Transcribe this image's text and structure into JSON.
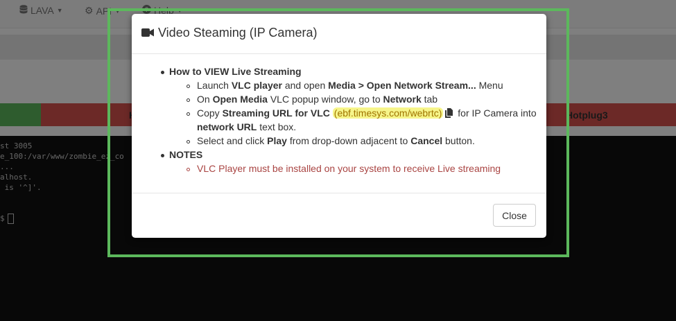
{
  "navbar": {
    "items": [
      {
        "label": "LAVA",
        "icon": "database-icon"
      },
      {
        "label": "API",
        "icon": "gear-icon"
      },
      {
        "label": "Help",
        "icon": "question-circle-icon"
      }
    ]
  },
  "tabs": {
    "left_label": "H",
    "right_label": "Hotplug3"
  },
  "terminal": {
    "lines": [
      "st 3005",
      "e_100:/var/www/zombie_ez_co",
      "...",
      "alhost.",
      " is '^]'.",
      "",
      "$"
    ]
  },
  "modal": {
    "title": "Video Steaming (IP Camera)",
    "title_icon": "video-camera-icon",
    "section1": {
      "heading": "How to VIEW Live Streaming",
      "step1": {
        "a": "Launch ",
        "b": "VLC player",
        "c": " and open ",
        "d": "Media > Open Network Stream...",
        "e": " Menu"
      },
      "step2": {
        "a": "On ",
        "b": "Open Media",
        "c": " VLC popup window, go to ",
        "d": "Network",
        "e": " tab"
      },
      "step3": {
        "a": "Copy ",
        "b": "Streaming URL for VLC",
        "url": "(ebf.timesys.com/webrtc)",
        "c": " for IP Camera into",
        "d": "network URL",
        "e": " text box."
      },
      "step4": {
        "a": "Select and click ",
        "b": "Play",
        "c": " from drop-down adjacent to ",
        "d": "Cancel",
        "e": " button."
      }
    },
    "section2": {
      "heading": "NOTES",
      "note1": "VLC Player must be installed on your system to receive Live streaming"
    },
    "close_label": "Close"
  },
  "colors": {
    "highlight_border": "#5cb85c",
    "tab_green": "#5cb85c",
    "tab_red": "#d9534f",
    "url_highlight": "#f6f58a",
    "note_text": "#a94442"
  }
}
